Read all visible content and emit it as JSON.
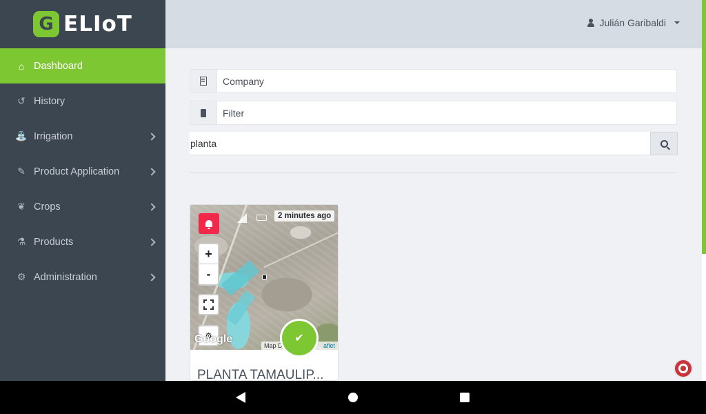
{
  "brand": {
    "logo_letter": "G",
    "name": "ELIoT",
    "accent": "#7dc832",
    "sidebar_bg": "#3b4651"
  },
  "header": {
    "user_name": "Julián Garibaldi"
  },
  "sidebar": {
    "items": [
      {
        "label": "Dashboard",
        "icon": "home-icon",
        "active": true,
        "has_children": false
      },
      {
        "label": "History",
        "icon": "history-icon",
        "active": false,
        "has_children": false
      },
      {
        "label": "Irrigation",
        "icon": "irrigation-icon",
        "active": false,
        "has_children": true
      },
      {
        "label": "Product Application",
        "icon": "wand-icon",
        "active": false,
        "has_children": true
      },
      {
        "label": "Crops",
        "icon": "leaf-icon",
        "active": false,
        "has_children": true
      },
      {
        "label": "Products",
        "icon": "flask-icon",
        "active": false,
        "has_children": true
      },
      {
        "label": "Administration",
        "icon": "gear-icon",
        "active": false,
        "has_children": true
      }
    ]
  },
  "filters": {
    "company_placeholder": "Company",
    "filter_placeholder": "Filter",
    "search_value": "planta"
  },
  "card": {
    "title": "PLANTA TAMAULIP...",
    "last_update": "2 minutes ago",
    "zoom_in": "+",
    "zoom_out": "-",
    "map_provider": "Google",
    "attribution_text": "Map Dat",
    "attribution_link": "aflet",
    "status": "ok",
    "status_color": "#7dc832",
    "alarm_color": "#f0284a"
  }
}
